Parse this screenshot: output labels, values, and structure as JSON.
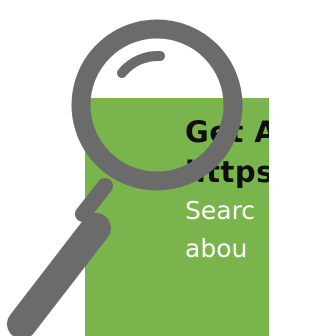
{
  "graphic": {
    "icon": "magnifying-glass-icon",
    "colors": {
      "panel": "#79b54c",
      "magnifier": "#6b6b6b",
      "title_text": "#0f0f0f",
      "body_text": "#ffffff",
      "background": "#ffffff"
    }
  },
  "panel": {
    "title_lines": [
      "Get A",
      "https"
    ],
    "body_lines": [
      "Searc",
      "abou"
    ]
  }
}
